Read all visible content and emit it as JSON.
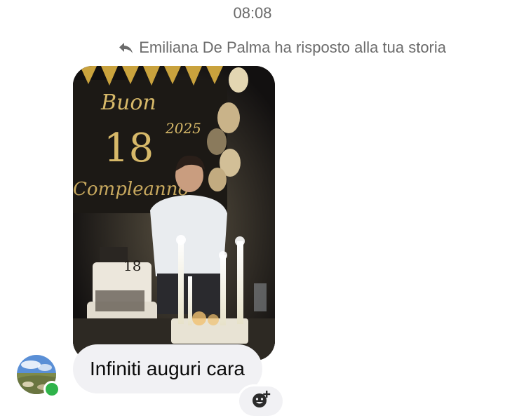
{
  "chat": {
    "timestamp": "08:08",
    "reply_note": "Emiliana De Palma ha risposto alla tua storia",
    "message": "Infiniti auguri cara"
  },
  "story": {
    "banner_text": "Buon",
    "age_number": "18",
    "year_text": "2025",
    "completion_text": "Compleanno",
    "cake_number": "18"
  },
  "icons": {
    "reply": "reply-arrow-icon",
    "reaction": "add-reaction-icon"
  },
  "colors": {
    "bubble_bg": "#f1f1f4",
    "muted_text": "#6b6b6b",
    "online": "#2fb34a"
  }
}
